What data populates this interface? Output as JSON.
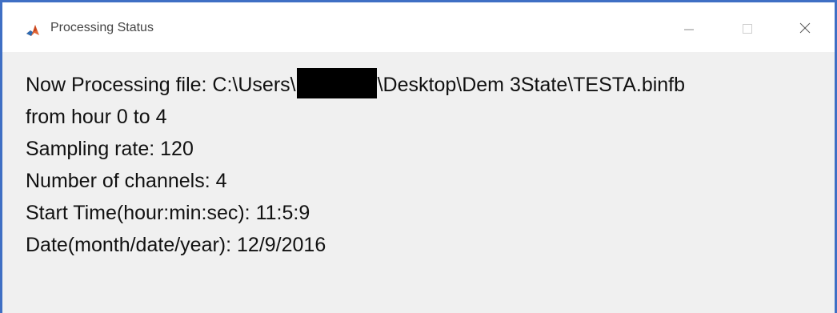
{
  "window": {
    "title": "Processing Status",
    "app_icon": "matlab-icon",
    "controls": {
      "minimize": "minimize-icon",
      "maximize": "maximize-icon",
      "close": "close-icon"
    }
  },
  "status": {
    "file_prefix": "Now Processing file: C:\\Users\\",
    "file_suffix": "\\Desktop\\Dem 3State\\TESTA.binfb",
    "hour_range": "from hour 0 to 4",
    "sampling_rate": "Sampling rate: 120",
    "channels": "Number of channels: 4",
    "start_time": "Start Time(hour:min:sec): 11:5:9",
    "date": "Date(month/date/year): 12/9/2016"
  },
  "colors": {
    "window_border": "#3f6fc4",
    "titlebar_bg": "#ffffff",
    "client_bg": "#f0f0f0",
    "text": "#111111",
    "redaction": "#000000"
  }
}
